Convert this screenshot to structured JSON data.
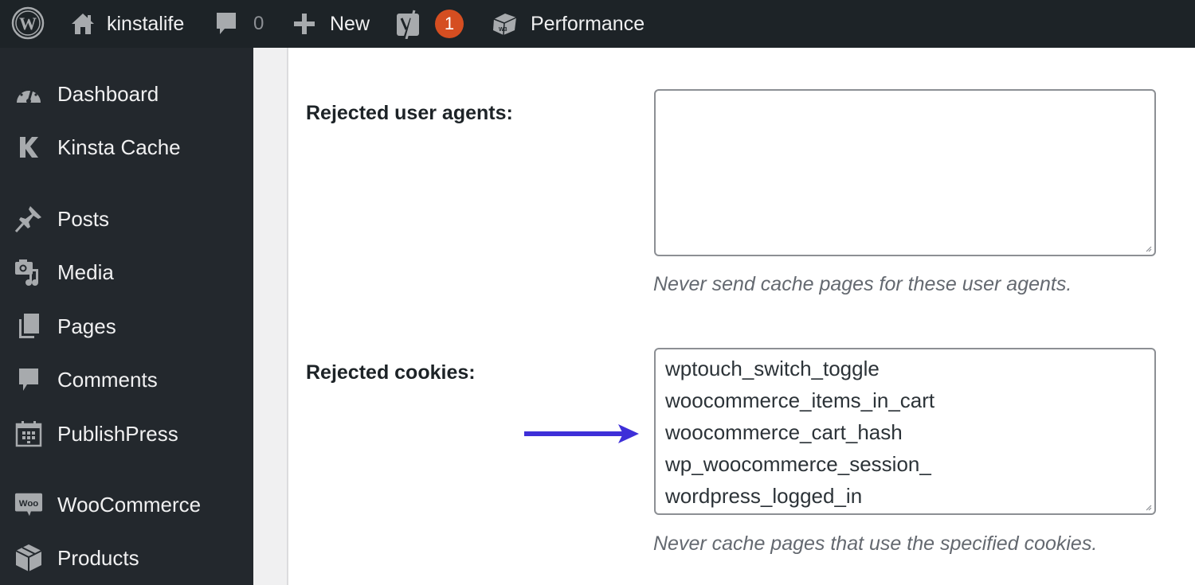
{
  "adminbar": {
    "wp_logo_icon": "wordpress-logo-icon",
    "site": {
      "icon": "home-icon",
      "label": "kinstalife"
    },
    "comments": {
      "icon": "comment-bubble-icon",
      "count": "0"
    },
    "new": {
      "icon": "plus-icon",
      "label": "New"
    },
    "yoast": {
      "icon": "yoast-icon",
      "badge": "1"
    },
    "performance": {
      "icon": "w3-total-cache-icon",
      "label": "Performance"
    },
    "colors": {
      "background": "#1d2327",
      "badge": "#d54e21"
    }
  },
  "sidebar": {
    "items": [
      {
        "label": "Dashboard",
        "icon": "dashboard-gauge-icon"
      },
      {
        "label": "Kinsta Cache",
        "icon": "kinsta-k-icon"
      },
      {
        "label": "Posts",
        "icon": "pushpin-icon"
      },
      {
        "label": "Media",
        "icon": "media-camera-music-icon"
      },
      {
        "label": "Pages",
        "icon": "pages-icon"
      },
      {
        "label": "Comments",
        "icon": "comment-bubble-icon"
      },
      {
        "label": "PublishPress",
        "icon": "calendar-icon"
      },
      {
        "label": "WooCommerce",
        "icon": "woo-icon"
      },
      {
        "label": "Products",
        "icon": "box-icon"
      }
    ]
  },
  "settings": {
    "rejected_user_agents": {
      "label": "Rejected user agents:",
      "value": "",
      "description": "Never send cache pages for these user agents."
    },
    "rejected_cookies": {
      "label": "Rejected cookies:",
      "lines": [
        "wptouch_switch_toggle",
        "woocommerce_items_in_cart",
        "woocommerce_cart_hash",
        "wp_woocommerce_session_",
        "wordpress_logged_in"
      ],
      "description": "Never cache pages that use the specified cookies."
    }
  },
  "annotation": {
    "icon": "arrow-right-icon",
    "color": "#3e2fd8"
  }
}
